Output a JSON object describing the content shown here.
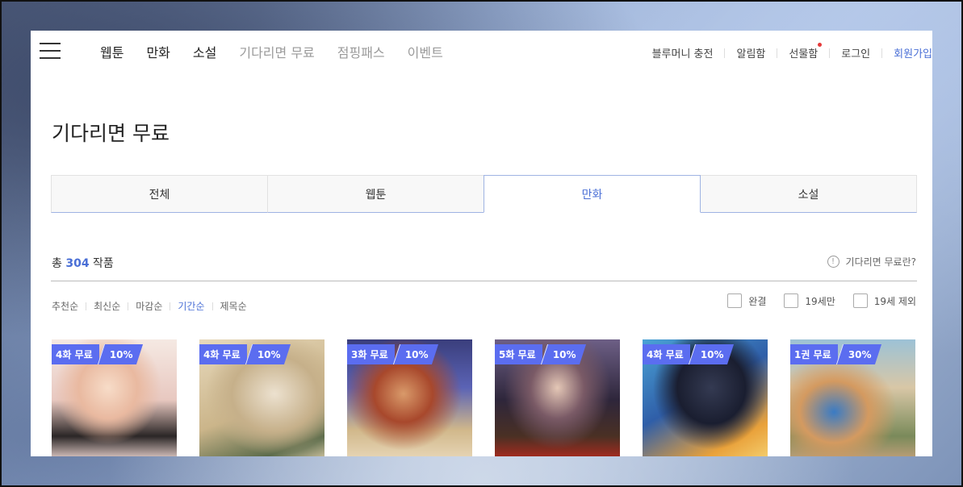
{
  "nav": {
    "links": [
      {
        "label": "웹툰",
        "dim": false
      },
      {
        "label": "만화",
        "dim": false
      },
      {
        "label": "소설",
        "dim": false
      },
      {
        "label": "기다리면 무료",
        "dim": true
      },
      {
        "label": "점핑패스",
        "dim": true
      },
      {
        "label": "이벤트",
        "dim": true
      }
    ],
    "util": {
      "charge": "블루머니 충전",
      "notice": "알림함",
      "gift": "선물함",
      "login": "로그인",
      "signup": "회원가입"
    }
  },
  "page_title": "기다리면 무료",
  "tabs": [
    {
      "label": "전체",
      "active": false
    },
    {
      "label": "웹툰",
      "active": false
    },
    {
      "label": "만화",
      "active": true
    },
    {
      "label": "소설",
      "active": false
    }
  ],
  "summary": {
    "prefix": "총",
    "count": "304",
    "suffix": "작품"
  },
  "help": {
    "icon": "info-circle-icon",
    "label": "기다리면 무료란?"
  },
  "sorts": [
    {
      "label": "추천순",
      "active": false
    },
    {
      "label": "최신순",
      "active": false
    },
    {
      "label": "마감순",
      "active": false
    },
    {
      "label": "기간순",
      "active": true
    },
    {
      "label": "제목순",
      "active": false
    }
  ],
  "filters": [
    {
      "label": "완결",
      "checked": false
    },
    {
      "label": "19세만",
      "checked": false
    },
    {
      "label": "19세 제외",
      "checked": false
    }
  ],
  "cards": [
    {
      "free": "4화 무료",
      "discount": "10%"
    },
    {
      "free": "4화 무료",
      "discount": "10%"
    },
    {
      "free": "3화 무료",
      "discount": "10%"
    },
    {
      "free": "5화 무료",
      "discount": "10%"
    },
    {
      "free": "4화 무료",
      "discount": "10%"
    },
    {
      "free": "1권 무료",
      "discount": "30%"
    }
  ],
  "colors": {
    "accent": "#4a6fd6",
    "badge": "#5b6df0",
    "dot": "#e53a3a"
  }
}
